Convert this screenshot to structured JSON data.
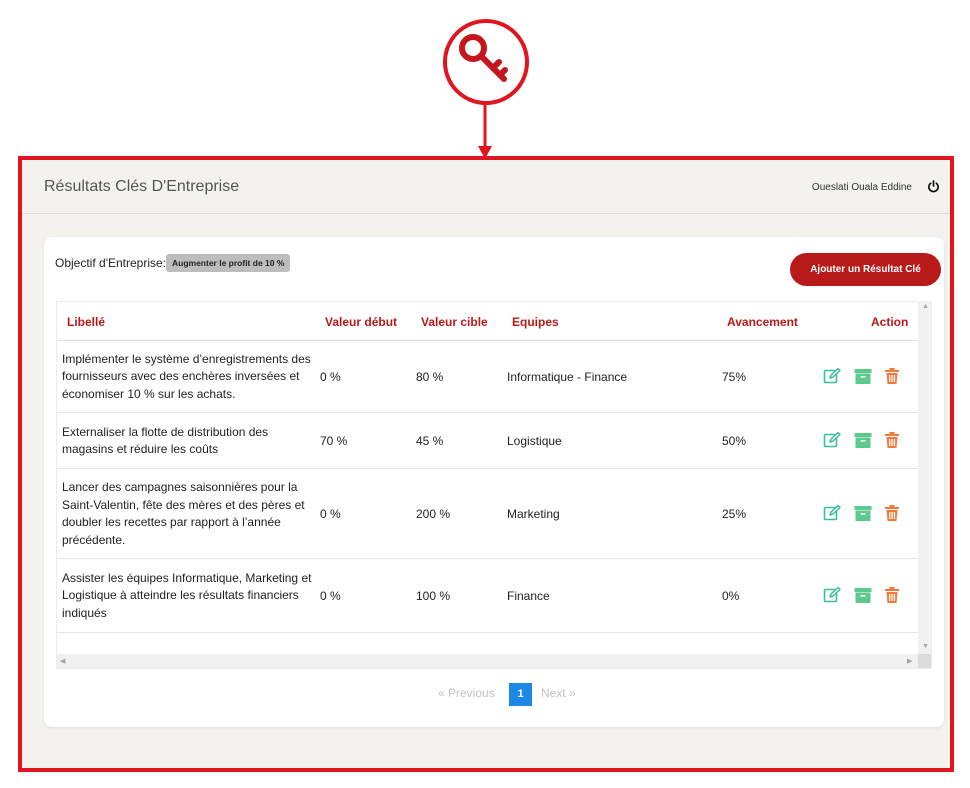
{
  "header": {
    "title": "Résultats Clés D'Entreprise",
    "user": "Oueslati Ouala Eddine"
  },
  "objective": {
    "label": "Objectif d'Entreprise:",
    "value": "Augmenter le profit de 10 %"
  },
  "add_button": "Ajouter un Résultat Clé",
  "table": {
    "columns": [
      "Libellé",
      "Valeur début",
      "Valeur cible",
      "Equipes",
      "Avancement",
      "Action"
    ],
    "rows": [
      {
        "label": "Implémenter le système d’enregistrements des fournisseurs avec des enchères inversées et économiser 10 % sur les achats.",
        "start": "0 %",
        "target": "80 %",
        "teams": "Informatique - Finance",
        "progress": "75%"
      },
      {
        "label": "Externaliser la flotte de distribution des magasins et réduire les coûts",
        "start": "70 %",
        "target": "45 %",
        "teams": "Logistique",
        "progress": "50%"
      },
      {
        "label": "Lancer des campagnes saisonnières pour la Saint-Valentin, fête des mères et des pères et doubler les recettes par rapport à l’année précédente.",
        "start": "0 %",
        "target": "200 %",
        "teams": "Marketing",
        "progress": "25%"
      },
      {
        "label": "Assister les équipes Informatique, Marketing et Logistique à atteindre les résultats financiers indiqués",
        "start": "0 %",
        "target": "100 %",
        "teams": "Finance",
        "progress": "0%"
      }
    ]
  },
  "pagination": {
    "prev": "«   Previous",
    "current": "1",
    "next": "Next   »"
  },
  "icons": {
    "key": "key-icon",
    "power": "power-icon",
    "edit": "edit-icon",
    "archive": "archive-icon",
    "delete": "trash-icon"
  },
  "colors": {
    "frame": "#e0151f",
    "accent": "#b81a1a",
    "edit": "#3bbf9b",
    "archive": "#5cc98d",
    "delete": "#f07a3a",
    "page_active": "#1e88e5"
  }
}
